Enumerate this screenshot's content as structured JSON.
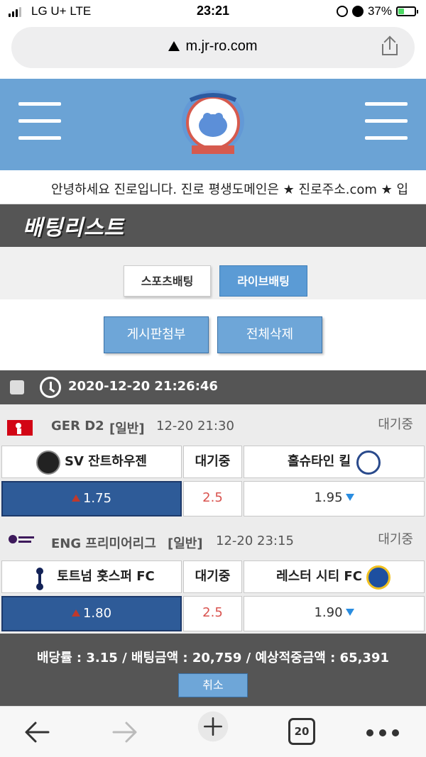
{
  "status_bar": {
    "carrier": "LG U+  LTE",
    "time": "23:21",
    "battery": "37%"
  },
  "browser": {
    "url": "m.jr-ro.com",
    "tab_count": "20"
  },
  "marquee": {
    "text": "안녕하세요 진로입니다. 진로 평생도메인은 ★ 진로주소.com ★ 입"
  },
  "page_title": "배팅리스트",
  "tabs": [
    {
      "label": "스포츠배팅"
    },
    {
      "label": "라이브배팅"
    }
  ],
  "actions": {
    "post": "게시판첨부",
    "delete_all": "전체삭제"
  },
  "bet": {
    "datetime": "2020-12-20 21:26:46",
    "matches": [
      {
        "league": "GER D2",
        "type": "[일반]",
        "time": "12-20 21:30",
        "status": "대기중",
        "home": "SV 잔트하우젠",
        "middle": "대기중",
        "away": "홀슈타인 킬",
        "home_odds": "1.75",
        "draw_odds": "2.5",
        "away_odds": "1.95"
      },
      {
        "league": "ENG 프리미어리그",
        "type": "[일반]",
        "time": "12-20 23:15",
        "status": "대기중",
        "home": "토트넘 홋스퍼 FC",
        "middle": "대기중",
        "away": "레스터 시티 FC",
        "home_odds": "1.80",
        "draw_odds": "2.5",
        "away_odds": "1.90"
      }
    ],
    "summary": "배당률 : 3.15 / 배팅금액 : 20,759 / 예상적중금액 : 65,391",
    "cancel_label": "취소"
  },
  "colors": {
    "header_blue": "#6ba3d5",
    "dark_bar": "#555555",
    "selected_odds": "#2e5b98",
    "draw_red": "#d9534f"
  }
}
